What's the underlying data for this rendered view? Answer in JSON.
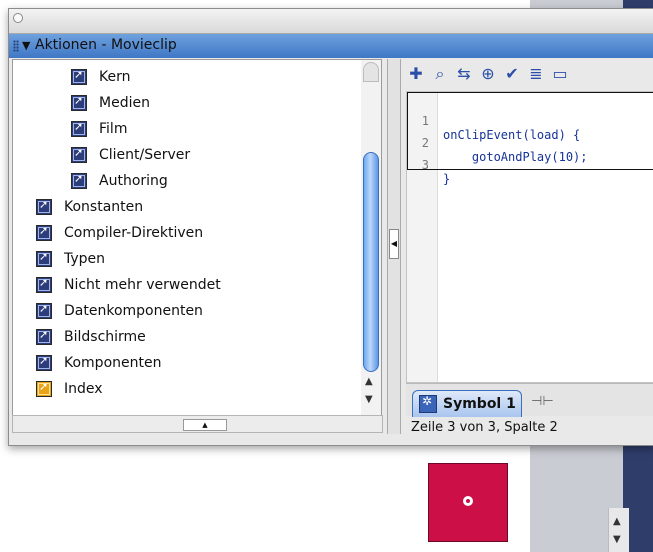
{
  "panel": {
    "title": "Aktionen - Movieclip"
  },
  "tree": {
    "items": [
      {
        "label": "Kern",
        "indent": 1,
        "gold": false
      },
      {
        "label": "Medien",
        "indent": 1,
        "gold": false
      },
      {
        "label": "Film",
        "indent": 1,
        "gold": false
      },
      {
        "label": "Client/Server",
        "indent": 1,
        "gold": false
      },
      {
        "label": "Authoring",
        "indent": 1,
        "gold": false
      },
      {
        "label": "Konstanten",
        "indent": 0,
        "gold": false
      },
      {
        "label": "Compiler-Direktiven",
        "indent": 0,
        "gold": false
      },
      {
        "label": "Typen",
        "indent": 0,
        "gold": false
      },
      {
        "label": "Nicht mehr verwendet",
        "indent": 0,
        "gold": false
      },
      {
        "label": "Datenkomponenten",
        "indent": 0,
        "gold": false
      },
      {
        "label": "Bildschirme",
        "indent": 0,
        "gold": false
      },
      {
        "label": "Komponenten",
        "indent": 0,
        "gold": false
      },
      {
        "label": "Index",
        "indent": 0,
        "gold": true
      }
    ]
  },
  "toolbar": {
    "icons": [
      "add-statement-icon",
      "find-icon",
      "replace-icon",
      "target-path-icon",
      "check-syntax-icon",
      "auto-format-icon",
      "code-hint-icon"
    ]
  },
  "code": {
    "lines": [
      {
        "num": "1",
        "text": "onClipEvent(load) {"
      },
      {
        "num": "2",
        "text": "    gotoAndPlay(10);"
      },
      {
        "num": "3",
        "text": "}"
      }
    ]
  },
  "script_tab": {
    "label": "Symbol 1"
  },
  "status": {
    "text": "Zeile 3 von 3, Spalte 2"
  },
  "colors": {
    "panel_header": "#4f87d3",
    "code_text": "#16339a",
    "stage_clip": "#cc0f46"
  }
}
